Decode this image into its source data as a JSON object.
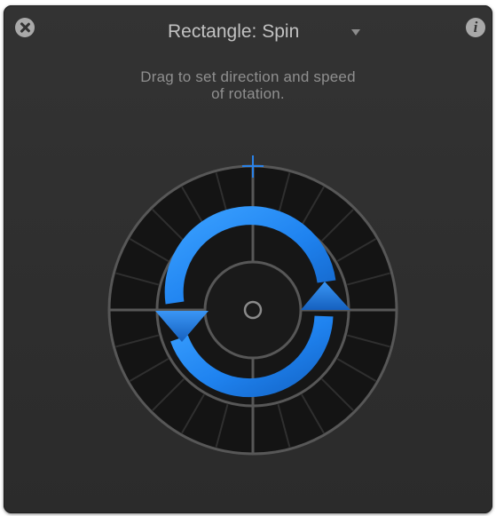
{
  "hud": {
    "title": "Rectangle: Spin",
    "instruction_line1": "Drag to set direction and speed",
    "instruction_line2": "of rotation.",
    "info_glyph": "i"
  },
  "icons": {
    "close": "close-icon",
    "info": "info-icon",
    "title_menu": "disclosure-triangle-icon",
    "spin": "rotation-arrows-icon",
    "crosshair": "crosshair-icon",
    "center": "center-point-icon"
  },
  "colors": {
    "panel": "#2e2e2e",
    "accent": "#1f83f0",
    "ring_line": "#555555",
    "ring_fill": "#141414"
  }
}
